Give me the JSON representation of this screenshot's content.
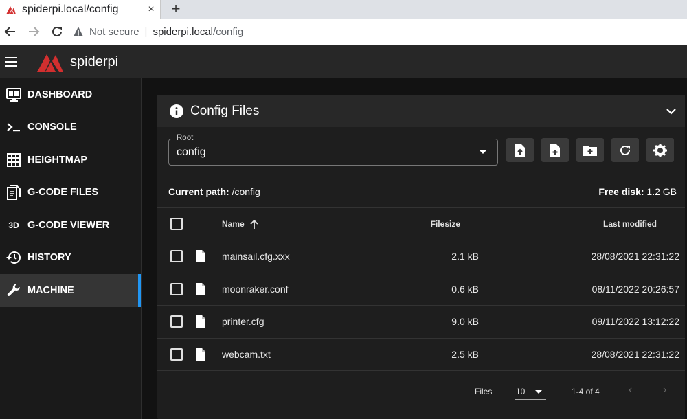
{
  "browser": {
    "tab_title": "spiderpi.local/config",
    "tab_close": "×",
    "new_tab": "+",
    "not_secure": "Not secure",
    "url_host": "spiderpi.local",
    "url_path": "/config"
  },
  "app": {
    "name": "spiderpi",
    "accent_color": "#d32f2f",
    "active_indicator_color": "#2196f3"
  },
  "sidebar": {
    "items": [
      {
        "label": "DASHBOARD",
        "icon": "monitor-dashboard-icon",
        "active": false
      },
      {
        "label": "CONSOLE",
        "icon": "console-icon",
        "active": false
      },
      {
        "label": "HEIGHTMAP",
        "icon": "grid-icon",
        "active": false
      },
      {
        "label": "G-CODE FILES",
        "icon": "file-document-icon",
        "active": false
      },
      {
        "label": "G-CODE VIEWER",
        "icon": "3d-icon",
        "icon_text": "3D",
        "active": false
      },
      {
        "label": "HISTORY",
        "icon": "history-icon",
        "active": false
      },
      {
        "label": "MACHINE",
        "icon": "wrench-icon",
        "active": true
      }
    ]
  },
  "panel": {
    "title": "Config Files",
    "root_label": "Root",
    "root_value": "config",
    "current_path_label": "Current path:",
    "current_path_value": "/config",
    "free_disk_label": "Free disk:",
    "free_disk_value": "1.2 GB"
  },
  "table": {
    "headers": {
      "name": "Name",
      "filesize": "Filesize",
      "modified": "Last modified"
    },
    "rows": [
      {
        "name": "mainsail.cfg.xxx",
        "size": "2.1 kB",
        "modified": "28/08/2021 22:31:22"
      },
      {
        "name": "moonraker.conf",
        "size": "0.6 kB",
        "modified": "08/11/2022 20:26:57"
      },
      {
        "name": "printer.cfg",
        "size": "9.0 kB",
        "modified": "09/11/2022 13:12:22"
      },
      {
        "name": "webcam.txt",
        "size": "2.5 kB",
        "modified": "28/08/2021 22:31:22"
      }
    ]
  },
  "footer": {
    "files_label": "Files",
    "per_page": "10",
    "range": "1-4 of 4",
    "prev": "‹",
    "next": "›"
  }
}
